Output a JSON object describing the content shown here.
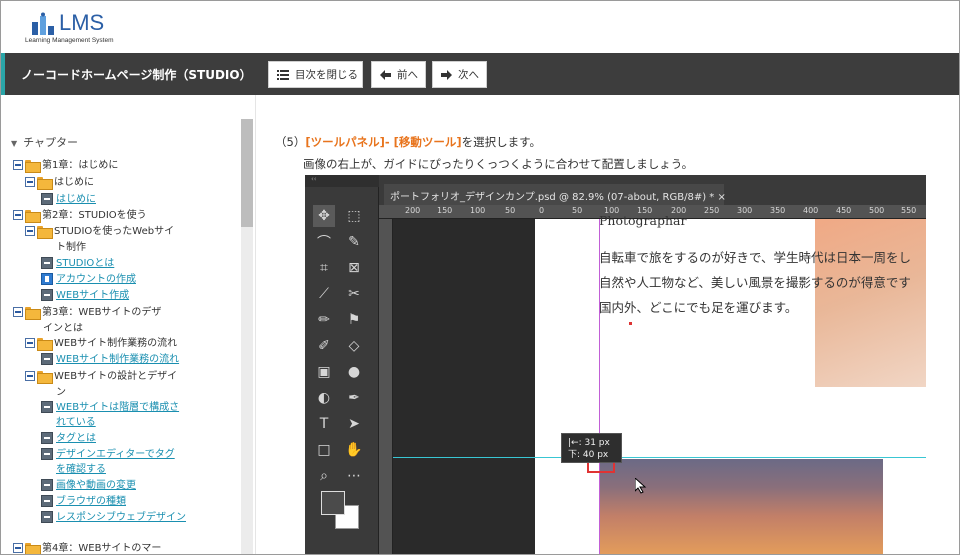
{
  "header": {
    "logo_text": "LMS",
    "logo_sub": "Learning Management System"
  },
  "titlebar": {
    "course_title": "ノーコードホームページ制作（STUDIO）",
    "toc_button": "目次を閉じる",
    "prev_button": "前へ",
    "next_button": "次へ"
  },
  "sidebar": {
    "heading": "チャプター",
    "items": [
      {
        "label": "第1章：はじめに"
      },
      {
        "label": "はじめに"
      },
      {
        "label": "はじめに"
      },
      {
        "label": "第2章：STUDIOを使う"
      },
      {
        "label": "STUDIOを使ったWebサイ"
      },
      {
        "label": "ト制作"
      },
      {
        "label": "STUDIOとは"
      },
      {
        "label": "アカウントの作成"
      },
      {
        "label": "WEBサイト作成"
      },
      {
        "label": "第3章：WEBサイトのデザ"
      },
      {
        "label": "インとは"
      },
      {
        "label": "WEBサイト制作業務の流れ"
      },
      {
        "label": "WEBサイト制作業務の流れ"
      },
      {
        "label": "WEBサイトの設計とデザイ"
      },
      {
        "label": "ン"
      },
      {
        "label": "WEBサイトは階層で構成さ"
      },
      {
        "label": "れている"
      },
      {
        "label": "タグとは"
      },
      {
        "label": "デザインエディターでタグ"
      },
      {
        "label": "を確認する"
      },
      {
        "label": "画像や動画の変更"
      },
      {
        "label": "ブラウザの種類"
      },
      {
        "label": "レスポンシブウェブデザイン"
      },
      {
        "label": "第4章：WEBサイトのマー"
      }
    ]
  },
  "content": {
    "step_prefix": "（5）",
    "step_hl1": "[ツールパネル]",
    "step_sep": "- ",
    "step_hl2": "[移動ツール]",
    "step_suffix": "を選択します。",
    "sub": "画像の右上が、ガイドにぴったりくっつくように合わせて配置しましょう。"
  },
  "ps": {
    "tab_label": "ポートフォリオ_デザインカンプ.psd @ 82.9% (07-about, RGB/8#) *",
    "ruler_ticks": [
      "200",
      "150",
      "100",
      "50",
      "0",
      "50",
      "100",
      "150",
      "200",
      "250",
      "300",
      "350",
      "400",
      "450",
      "500",
      "550"
    ],
    "text_line0": "Photographar",
    "text_line1": "自転車で旅をするのが好きで、学生時代は日本一周をし",
    "text_line2": "自然や人工物など、美しい風景を撮影するのが得意です",
    "text_line3": "国内外、どこにでも足を運びます。",
    "tooltip_line1": "|←: 31 px",
    "tooltip_line2": "下: 40 px"
  }
}
